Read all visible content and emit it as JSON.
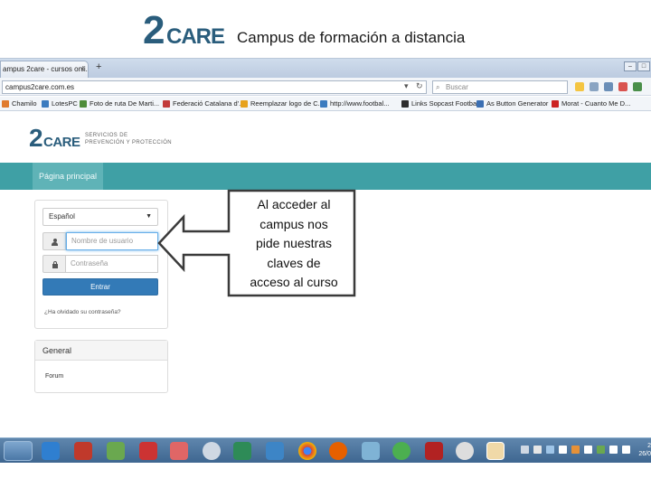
{
  "slide": {
    "logo_text": "2CARE",
    "title": "Campus de formación a distancia"
  },
  "browser": {
    "tab_label": "ampus 2care - cursos onli...",
    "tab_close": "×",
    "new_tab": "+",
    "url": "campus2care.com.es",
    "search_placeholder": "Buscar",
    "bookmarks": [
      {
        "label": "Chamilo",
        "color": "#e07b2e"
      },
      {
        "label": "LotesPC",
        "color": "#3b7bbf"
      },
      {
        "label": "Foto de ruta De Marti...",
        "color": "#4e8c3a"
      },
      {
        "label": "Federació Catalana d'...",
        "color": "#c23b3b"
      },
      {
        "label": "Reemplazar logo de C...",
        "color": "#e7a21d"
      },
      {
        "label": "http://www.footbal...",
        "color": "#3b7bbf"
      },
      {
        "label": "Links Sopcast Football",
        "color": "#2d2d2d"
      },
      {
        "label": "As Button Generator",
        "color": "#3b6fb3"
      },
      {
        "label": "Morat - Cuanto Me D...",
        "color": "#c22"
      }
    ]
  },
  "site": {
    "logo_text": "2CARE",
    "tagline_1": "SERVICIOS DE",
    "tagline_2": "PREVENCIÓN Y PROTECCIÓN",
    "nav_home": "Página principal",
    "login": {
      "language": "Español",
      "username_placeholder": "Nombre de usuario",
      "password_placeholder": "Contraseña",
      "button": "Entrar",
      "forgot": "¿Ha olvidado su contraseña?"
    },
    "general": {
      "heading": "General",
      "forum_link": "Forum"
    }
  },
  "callout": {
    "lines": [
      "Al acceder al",
      "campus nos",
      "pide nuestras",
      "claves de",
      "acceso al curso"
    ]
  },
  "taskbar": {
    "clock_line1": "2",
    "clock_line2": "26/0"
  }
}
